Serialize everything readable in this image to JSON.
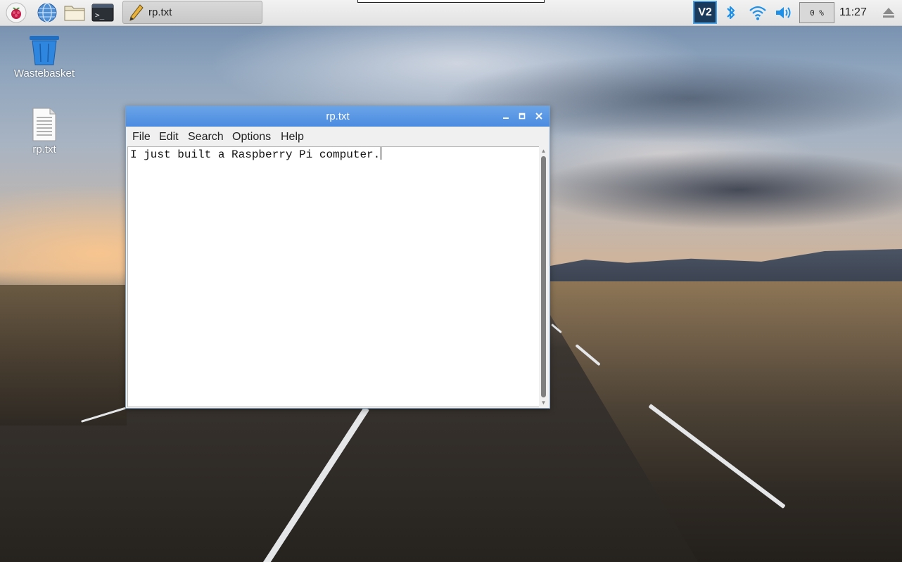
{
  "taskbar": {
    "launchers": [
      {
        "name": "raspberry-menu-icon"
      },
      {
        "name": "web-browser-icon"
      },
      {
        "name": "file-manager-icon"
      },
      {
        "name": "terminal-icon"
      }
    ],
    "task_button": {
      "label": "rp.txt",
      "icon": "text-editor-pencil-icon"
    },
    "tray": {
      "vnc_label": "V2",
      "icons": [
        "vnc-icon",
        "bluetooth-icon",
        "wifi-icon",
        "volume-icon"
      ],
      "cpu_label": "0 %",
      "clock": "11:27",
      "eject_icon": "eject-icon"
    }
  },
  "desktop": {
    "icons": [
      {
        "label": "Wastebasket",
        "icon": "wastebasket-icon"
      },
      {
        "label": "rp.txt",
        "icon": "text-file-icon"
      }
    ]
  },
  "window": {
    "title": "rp.txt",
    "controls": [
      "minimize-icon",
      "maximize-icon",
      "close-icon"
    ],
    "menu": [
      "File",
      "Edit",
      "Search",
      "Options",
      "Help"
    ],
    "content": "I just built a Raspberry Pi computer."
  },
  "colors": {
    "titlebar": "#4b8be0",
    "taskbar": "#ebebeb",
    "accent_blue": "#1e90e8"
  }
}
